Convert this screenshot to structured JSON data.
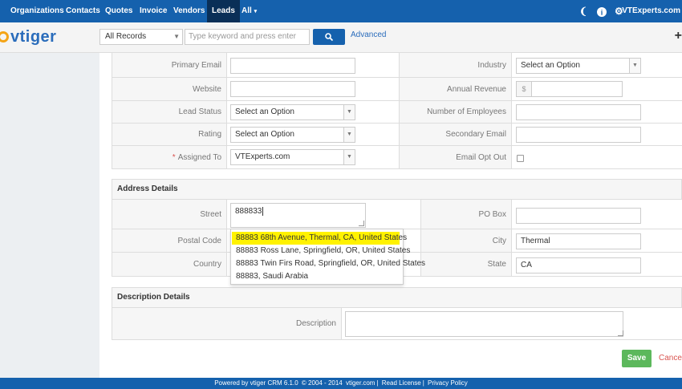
{
  "nav": {
    "items": [
      "Organizations",
      "Contacts",
      "Quotes",
      "Invoice",
      "Vendors",
      "Leads",
      "All"
    ],
    "active": "Leads",
    "user": "VTExperts.com"
  },
  "header": {
    "logo": "vtiger",
    "records_select": "All Records",
    "search_placeholder": "Type keyword and press enter",
    "advanced": "Advanced"
  },
  "lead_info": {
    "primary_email_label": "Primary Email",
    "primary_email_value": "",
    "industry_label": "Industry",
    "industry_value": "Select an Option",
    "website_label": "Website",
    "website_value": "",
    "annual_revenue_label": "Annual Revenue",
    "annual_revenue_currency": "$",
    "annual_revenue_value": "",
    "lead_status_label": "Lead Status",
    "lead_status_value": "Select an Option",
    "num_employees_label": "Number of Employees",
    "num_employees_value": "",
    "rating_label": "Rating",
    "rating_value": "Select an Option",
    "secondary_email_label": "Secondary Email",
    "secondary_email_value": "",
    "assigned_to_label": "Assigned To",
    "assigned_to_required": "*",
    "assigned_to_value": "VTExperts.com",
    "email_opt_out_label": "Email Opt Out",
    "email_opt_out_checked": false
  },
  "address": {
    "section_title": "Address Details",
    "street_label": "Street",
    "street_value": "888833",
    "po_box_label": "PO Box",
    "po_box_value": "",
    "postal_code_label": "Postal Code",
    "city_label": "City",
    "city_value": "Thermal",
    "country_label": "Country",
    "state_label": "State",
    "state_value": "CA",
    "suggestions": [
      "88883 68th Avenue, Thermal, CA, United States",
      "88883 Ross Lane, Springfield, OR, United States",
      "88883 Twin Firs Road, Springfield, OR, United States",
      "88883, Saudi Arabia"
    ],
    "highlighted_suggestion": 0
  },
  "description": {
    "section_title": "Description Details",
    "description_label": "Description",
    "description_value": ""
  },
  "actions": {
    "save": "Save",
    "cancel": "Cancel"
  },
  "footer": {
    "powered": "Powered by vtiger CRM 6.1.0",
    "copyright": "© 2004 - 2014",
    "site": "vtiger.com",
    "read_license": "Read License",
    "privacy": "Privacy Policy"
  },
  "colors": {
    "nav_bg": "#1561ad",
    "nav_active": "#0a2f57",
    "save_bg": "#5cb85c",
    "highlight": "#fff200"
  }
}
